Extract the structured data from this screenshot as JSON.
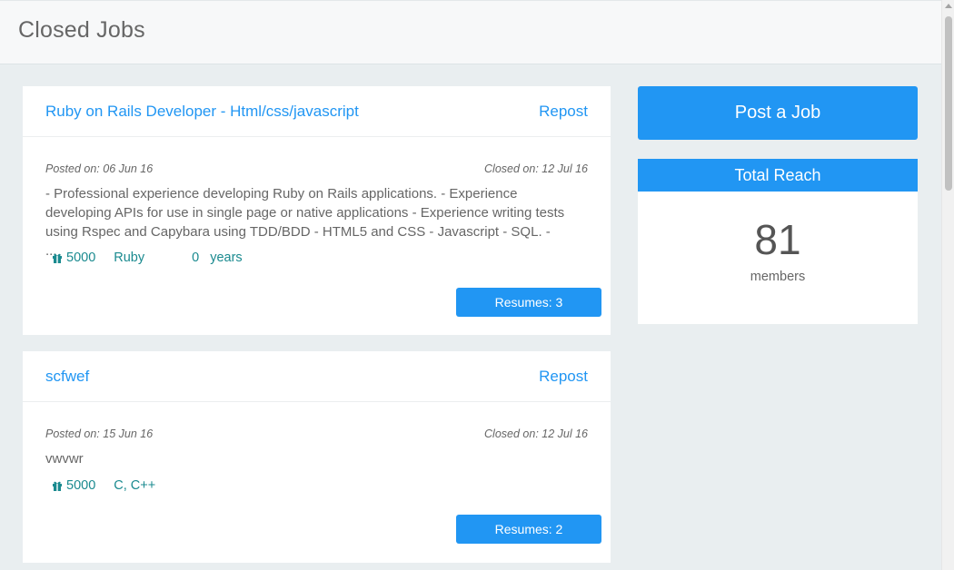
{
  "header": {
    "title": "Closed Jobs"
  },
  "jobs": [
    {
      "title": "Ruby on Rails Developer - Html/css/javascript",
      "repost_label": "Repost",
      "posted": "Posted on: 06 Jun 16",
      "closed": "Closed on: 12 Jul 16",
      "description": "- Professional experience developing Ruby on Rails applications. - Experience developing APIs for use in single page or native applications - Experience writing tests using Rspec and Capybara using TDD/BDD - HTML5 and CSS - Javascript - SQL. - ...",
      "salary": "5000",
      "skills": "Ruby",
      "experience": "0",
      "experience_unit": "years",
      "resumes_label": "Resumes: 3"
    },
    {
      "title": "scfwef",
      "repost_label": "Repost",
      "posted": "Posted on: 15 Jun 16",
      "closed": "Closed on: 12 Jul 16",
      "description": "vwvwr",
      "salary": "5000",
      "skills": "C, C++",
      "resumes_label": "Resumes: 2"
    }
  ],
  "sidebar": {
    "post_job_label": "Post a Job",
    "reach_title": "Total Reach",
    "reach_count": "81",
    "reach_unit": "members"
  },
  "icons": {
    "salary": "gift-icon"
  },
  "colors": {
    "accent": "#2196f3",
    "meta_text": "#1a8a8f",
    "background": "#e9eef0"
  }
}
